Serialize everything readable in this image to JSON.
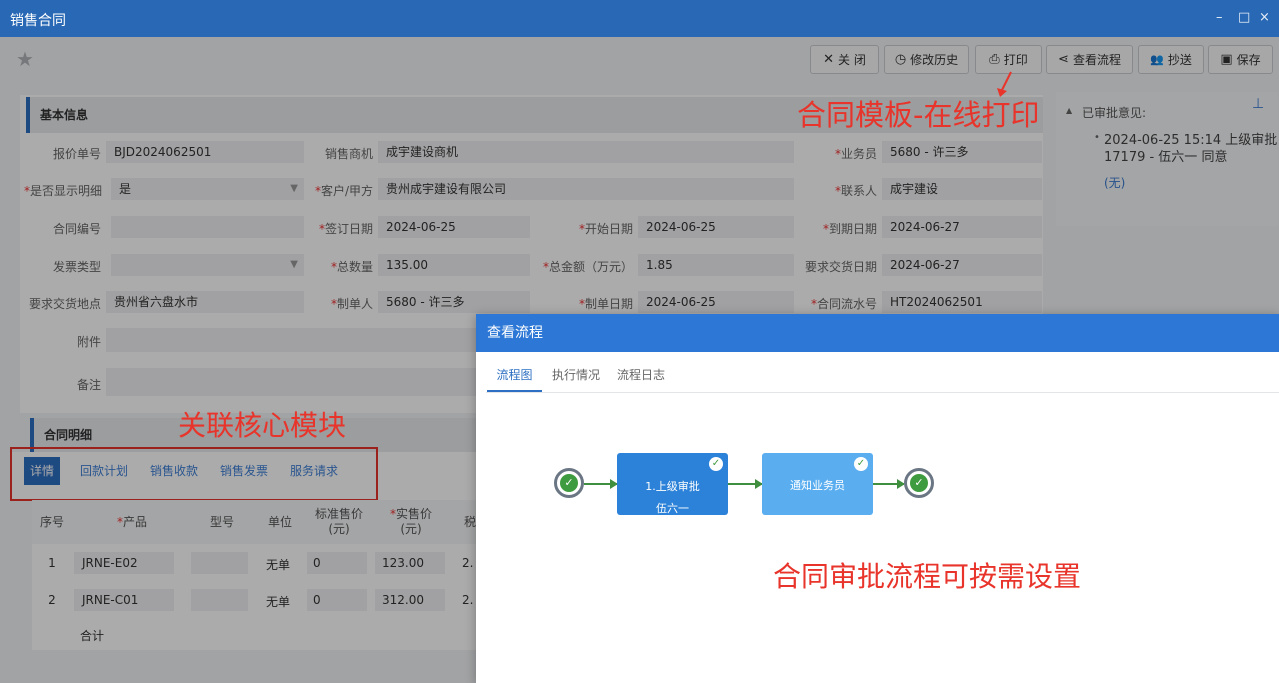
{
  "window": {
    "title": "销售合同",
    "min": "–",
    "max": "□",
    "close": "×"
  },
  "toolbar": [
    {
      "icon": "✕",
      "label": "关 闭"
    },
    {
      "icon": "◷",
      "label": "修改历史"
    },
    {
      "icon": "⎙",
      "label": "打印"
    },
    {
      "icon": "⋖",
      "label": "查看流程"
    },
    {
      "icon": "👥",
      "label": "抄送"
    },
    {
      "icon": "▣",
      "label": "保存"
    }
  ],
  "section_basic": "基本信息",
  "form": {
    "quote_no_label": "报价单号",
    "quote_no": "BJD2024062501",
    "dealer_label": "销售商机",
    "dealer": "成宇建设商机",
    "salesman_label": "业务员",
    "salesman": "5680 - 许三多",
    "show_detail_label": "是否显示明细",
    "show_detail": "是",
    "customer_label": "客户/甲方",
    "customer": "贵州成宇建设有限公司",
    "contact_label": "联系人",
    "contact": "成宇建设",
    "contract_no_label": "合同编号",
    "contract_no": "",
    "sign_date_label": "签订日期",
    "sign_date": "2024-06-25",
    "start_date_label": "开始日期",
    "start_date": "2024-06-25",
    "end_date_label": "到期日期",
    "end_date": "2024-06-27",
    "invoice_type_label": "发票类型",
    "invoice_type": "",
    "total_qty_label": "总数量",
    "total_qty": "135.00",
    "total_amount_label": "总金额（万元）",
    "total_amount": "1.85",
    "delivery_date_label": "要求交货日期",
    "delivery_date": "2024-06-27",
    "delivery_place_label": "要求交货地点",
    "delivery_place": "贵州省六盘水市",
    "creator_label": "制单人",
    "creator": "5680 - 许三多",
    "create_date_label": "制单日期",
    "create_date": "2024-06-25",
    "serial_label": "合同流水号",
    "serial": "HT2024062501",
    "attachment_label": "附件",
    "remark_label": "备注"
  },
  "approval": {
    "title": "已审批意见:",
    "item": "2024-06-25 15:14 上级审批 17179 - 伍六一 同意",
    "none": "(无)"
  },
  "annotations": {
    "print": "合同模板-在线打印",
    "modules": "关联核心模块",
    "flow": "合同审批流程可按需设置"
  },
  "section_detail": "合同明细",
  "detail_tabs": [
    "详情",
    "回款计划",
    "销售收款",
    "销售发票",
    "服务请求"
  ],
  "grid": {
    "headers": [
      "序号",
      "产品",
      "型号",
      "单位",
      "标准售价\n(元)",
      "实售价\n(元)",
      "税"
    ],
    "rows": [
      {
        "no": "1",
        "product": "JRNE-E02",
        "model": "",
        "unit": "无单",
        "std": "0",
        "price": "123.00",
        "tax": "2."
      },
      {
        "no": "2",
        "product": "JRNE-C01",
        "model": "",
        "unit": "无单",
        "std": "0",
        "price": "312.00",
        "tax": "2."
      }
    ],
    "total_label": "合计"
  },
  "modal": {
    "title": "查看流程",
    "tabs": [
      "流程图",
      "执行情况",
      "流程日志"
    ],
    "node1_line1": "1.上级审批",
    "node1_line2": "伍六一",
    "node2": "通知业务员"
  },
  "colors": {
    "titlebar": "#2868b4",
    "accent": "#2d6fc2",
    "annotation": "#e8342a",
    "node_active": "#2c82d8",
    "node_pending": "#5aaef0"
  }
}
